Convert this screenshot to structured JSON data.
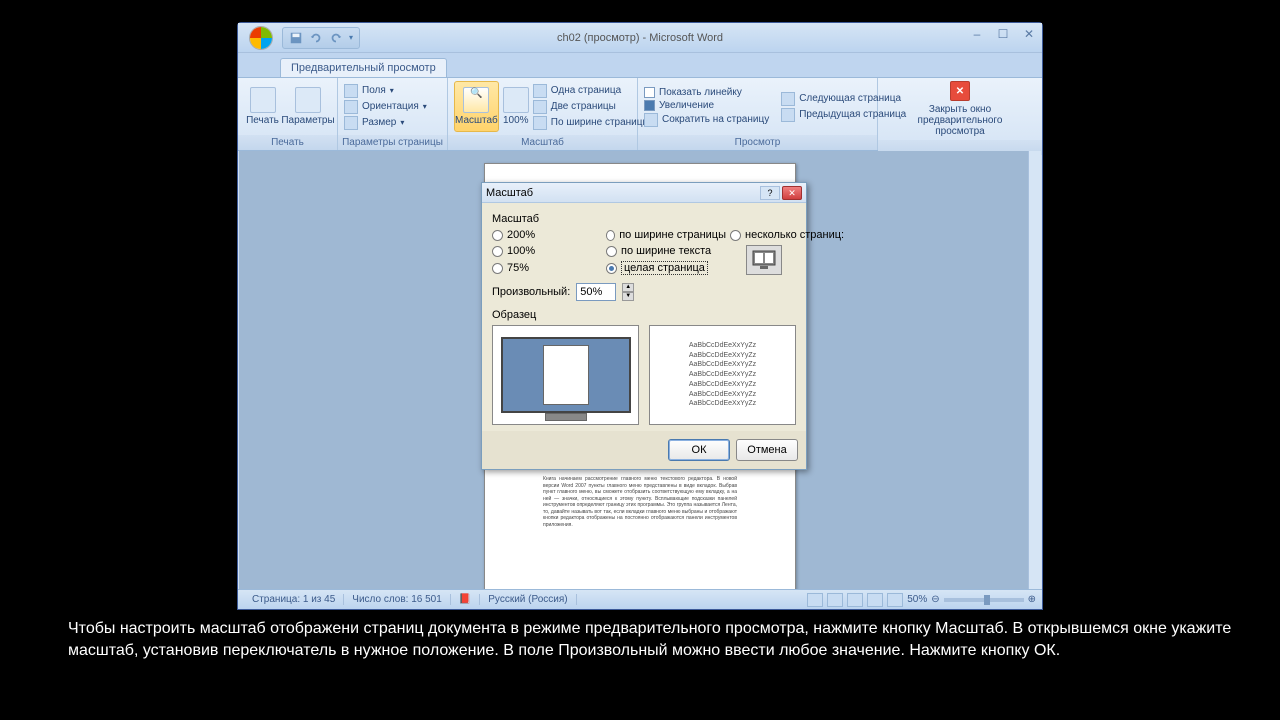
{
  "window": {
    "title": "ch02 (просмотр) - Microsoft Word",
    "tab": "Предварительный просмотр"
  },
  "ribbon": {
    "print": {
      "print": "Печать",
      "options": "Параметры",
      "group": "Печать"
    },
    "page_setup": {
      "margins": "Поля",
      "orientation": "Ориентация",
      "size": "Размер",
      "group": "Параметры страницы"
    },
    "zoom": {
      "zoom": "Масштаб",
      "hundred": "100%",
      "one_page": "Одна страница",
      "two_pages": "Две страницы",
      "page_width": "По ширине страницы",
      "group": "Масштаб"
    },
    "preview": {
      "show_ruler": "Показать линейку",
      "magnifier": "Увеличение",
      "shrink": "Сократить на страницу",
      "next": "Следующая страница",
      "prev": "Предыдущая страница",
      "close": "Закрыть окно предварительного просмотра",
      "group": "Просмотр"
    }
  },
  "dialog": {
    "title": "Масштаб",
    "section": "Масштаб",
    "r200": "200%",
    "r100": "100%",
    "r75": "75%",
    "page_width": "по ширине страницы",
    "text_width": "по ширине текста",
    "whole_page": "целая страница",
    "many_pages": "несколько страниц:",
    "custom_label": "Произвольный:",
    "custom_value": "50%",
    "sample_label": "Образец",
    "sample_text": "АaBbCcDdEeXxYyZz\nАaBbCcDdEeXxYyZz\nАaBbCcDdEeXxYyZz\nАaBbCcDdEeXxYyZz\nАaBbCcDdEeXxYyZz\nАaBbCcDdEeXxYyZz\nАaBbCcDdEeXxYyZz",
    "ok": "ОК",
    "cancel": "Отмена"
  },
  "statusbar": {
    "page": "Страница: 1 из 45",
    "words": "Число слов: 16 501",
    "lang": "Русский (Россия)",
    "zoom": "50%"
  },
  "caption": "Чтобы настроить масштаб отображени  страниц   документа в   режиме   предварительного просмотра, нажмите кнопку Масштаб. В открывшемся окне  укажите   масштаб,   установив переключатель в нужное положение. В поле Произвольный можно ввести любое значение. Нажмите кнопку ОК."
}
